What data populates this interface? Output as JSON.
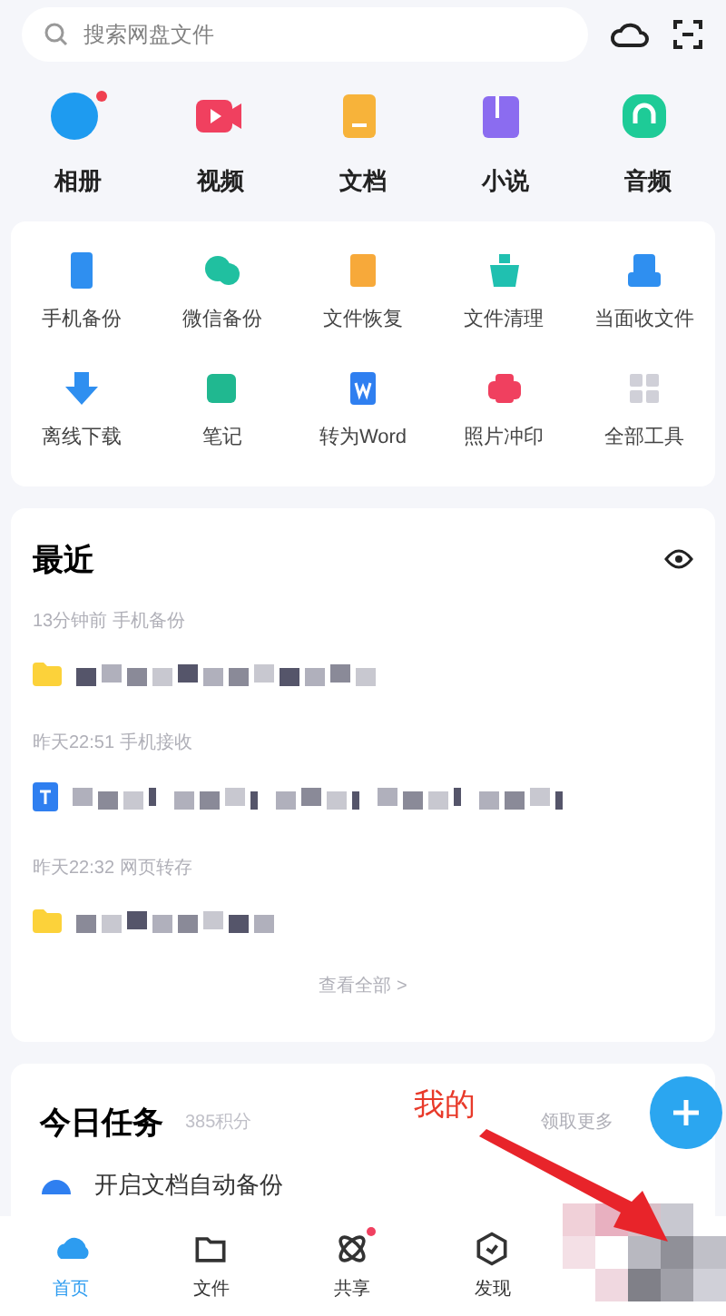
{
  "search": {
    "placeholder": "搜索网盘文件"
  },
  "categories": [
    {
      "label": "相册",
      "dot": true
    },
    {
      "label": "视频",
      "dot": false
    },
    {
      "label": "文档",
      "dot": false
    },
    {
      "label": "小说",
      "dot": false
    },
    {
      "label": "音频",
      "dot": false
    }
  ],
  "tools": [
    {
      "label": "手机备份"
    },
    {
      "label": "微信备份"
    },
    {
      "label": "文件恢复"
    },
    {
      "label": "文件清理"
    },
    {
      "label": "当面收文件"
    },
    {
      "label": "离线下载"
    },
    {
      "label": "笔记"
    },
    {
      "label": "转为Word"
    },
    {
      "label": "照片冲印"
    },
    {
      "label": "全部工具"
    }
  ],
  "recent": {
    "title": "最近",
    "items": [
      {
        "meta": "13分钟前  手机备份",
        "kind": "folder"
      },
      {
        "meta": "昨天22:51  手机接收",
        "kind": "doc"
      },
      {
        "meta": "昨天22:32  网页转存",
        "kind": "folder"
      }
    ],
    "more": "查看全部 >"
  },
  "tasks": {
    "title": "今日任务",
    "points": "385积分",
    "more": "领取更多",
    "item": "开启文档自动备份"
  },
  "annotation": "我的",
  "nav": [
    {
      "label": "首页",
      "selected": true,
      "dot": false
    },
    {
      "label": "文件",
      "selected": false,
      "dot": false
    },
    {
      "label": "共享",
      "selected": false,
      "dot": true
    },
    {
      "label": "发现",
      "selected": false,
      "dot": false
    }
  ]
}
